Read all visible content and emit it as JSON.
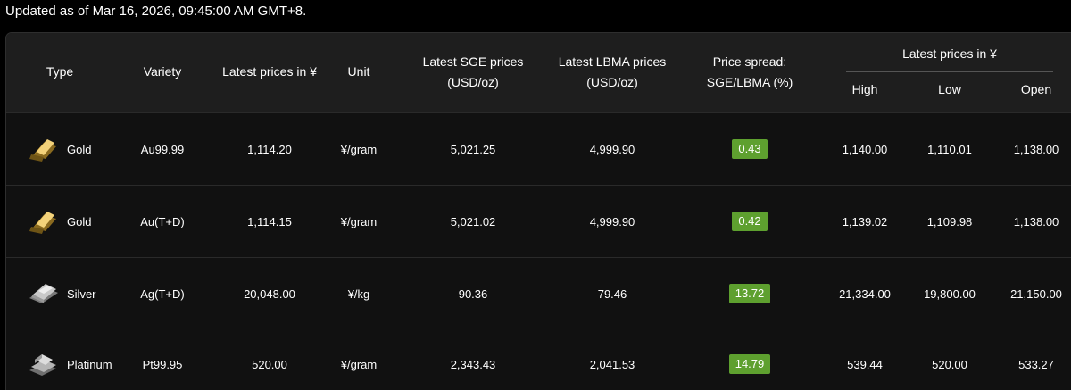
{
  "updated": "Updated as of Mar 16, 2026, 09:45:00 AM GMT+8.",
  "header": {
    "type": "Type",
    "variety": "Variety",
    "latest_prices": "Latest prices in ¥",
    "unit": "Unit",
    "sge_line1": "Latest SGE prices",
    "sge_line2": "(USD/oz)",
    "lbma_line1": "Latest LBMA prices",
    "lbma_line2": "(USD/oz)",
    "spread_line1": "Price spread:",
    "spread_line2": "SGE/LBMA (%)",
    "group_title": "Latest prices in ¥",
    "high": "High",
    "low": "Low",
    "open": "Open"
  },
  "colors": {
    "badge_green": "#5ea02f",
    "gold": "#d9a937",
    "silver": "#c9c9c9",
    "platinum": "#b5b5b5"
  },
  "rows": [
    {
      "type": "Gold",
      "icon": "gold-bar-icon",
      "variety": "Au99.99",
      "latest": "1,114.20",
      "unit": "¥/gram",
      "sge": "5,021.25",
      "lbma": "4,999.90",
      "spread": "0.43",
      "high": "1,140.00",
      "low": "1,110.01",
      "open": "1,138.00"
    },
    {
      "type": "Gold",
      "icon": "gold-bar-icon",
      "variety": "Au(T+D)",
      "latest": "1,114.15",
      "unit": "¥/gram",
      "sge": "5,021.02",
      "lbma": "4,999.90",
      "spread": "0.42",
      "high": "1,139.02",
      "low": "1,109.98",
      "open": "1,138.00"
    },
    {
      "type": "Silver",
      "icon": "silver-bar-icon",
      "variety": "Ag(T+D)",
      "latest": "20,048.00",
      "unit": "¥/kg",
      "sge": "90.36",
      "lbma": "79.46",
      "spread": "13.72",
      "high": "21,334.00",
      "low": "19,800.00",
      "open": "21,150.00"
    },
    {
      "type": "Platinum",
      "icon": "platinum-bar-icon",
      "variety": "Pt99.95",
      "latest": "520.00",
      "unit": "¥/gram",
      "sge": "2,343.43",
      "lbma": "2,041.53",
      "spread": "14.79",
      "high": "539.44",
      "low": "520.00",
      "open": "533.27"
    }
  ]
}
